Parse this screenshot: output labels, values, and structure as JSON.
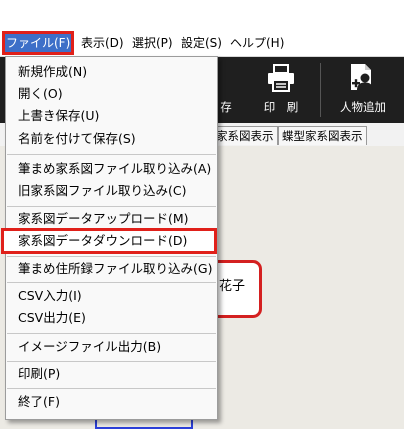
{
  "menubar": {
    "items": [
      {
        "label": "ファイル(F)"
      },
      {
        "label": "表示(D)"
      },
      {
        "label": "選択(P)"
      },
      {
        "label": "設定(S)"
      },
      {
        "label": "ヘルプ(H)"
      }
    ]
  },
  "toolbar": {
    "save_label": "存",
    "print_label": "印　刷",
    "add_person_label": "人物追加"
  },
  "tabs": [
    {
      "label": "家系図表示"
    },
    {
      "label": "蝶型家系図表示"
    }
  ],
  "canvas": {
    "person_name": "花子"
  },
  "file_menu": {
    "items": [
      {
        "label": "新規作成(N)"
      },
      {
        "label": "開く(O)"
      },
      {
        "label": "上書き保存(U)"
      },
      {
        "label": "名前を付けて保存(S)"
      },
      {
        "label": "筆まめ家系図ファイル取り込み(A)"
      },
      {
        "label": "旧家系図ファイル取り込み(C)"
      },
      {
        "label": "家系図データアップロード(M)"
      },
      {
        "label": "家系図データダウンロード(D)"
      },
      {
        "label": "筆まめ住所録ファイル取り込み(G)"
      },
      {
        "label": "CSV入力(I)"
      },
      {
        "label": "CSV出力(E)"
      },
      {
        "label": "イメージファイル出力(B)"
      },
      {
        "label": "印刷(P)"
      },
      {
        "label": "終了(F)"
      }
    ]
  },
  "colors": {
    "highlight_border": "#e0201a",
    "active_menu_bg": "#3d6fc8",
    "toolbar_bg": "#1f1f1f"
  }
}
